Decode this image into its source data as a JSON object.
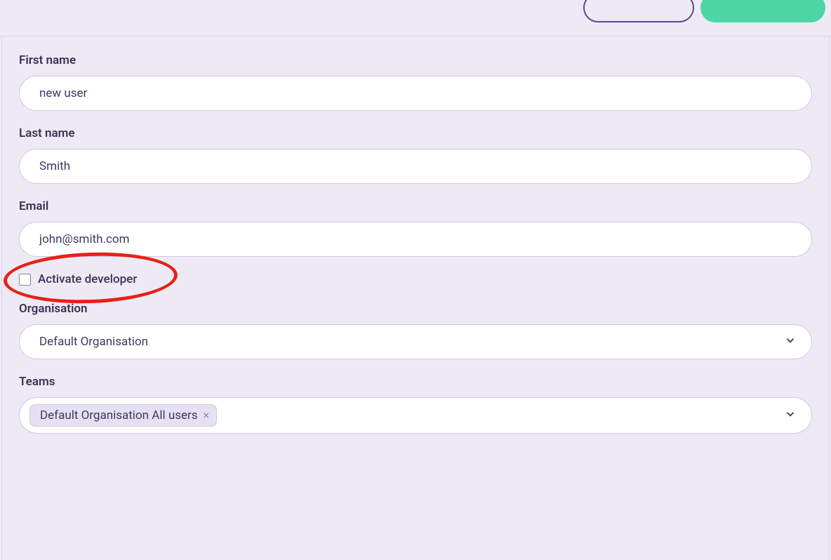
{
  "form": {
    "first_name": {
      "label": "First name",
      "value": "new user"
    },
    "last_name": {
      "label": "Last name",
      "value": "Smith"
    },
    "email": {
      "label": "Email",
      "value": "john@smith.com"
    },
    "activate_developer": {
      "label": "Activate developer",
      "checked": false
    },
    "organisation": {
      "label": "Organisation",
      "selected": "Default Organisation"
    },
    "teams": {
      "label": "Teams",
      "tags": [
        {
          "label": "Default Organisation All users"
        }
      ]
    }
  }
}
